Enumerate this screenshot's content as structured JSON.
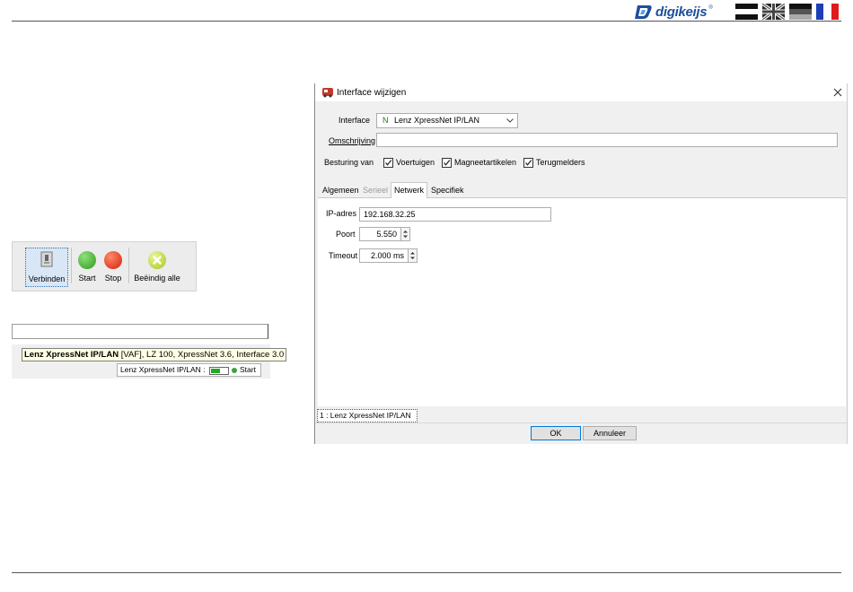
{
  "header": {
    "logo_text": "digikeijs",
    "logo_reg": "®",
    "flags": [
      "nl-flag",
      "uk-flag",
      "de-flag",
      "fr-flag"
    ]
  },
  "toolbar": {
    "connect_label": "Verbinden",
    "start_label": "Start",
    "stop_label": "Stop",
    "stop_all_label": "Beëindig alle"
  },
  "status": {
    "tooltip_bold": "Lenz XpressNet IP/LAN",
    "tooltip_rest": " [VAF], LZ 100, XpressNet 3.6, Interface 3.0",
    "connection_label": "Lenz XpressNet IP/LAN :",
    "connection_state": "Start"
  },
  "dialog": {
    "title": "Interface wijzigen",
    "interface_label": "Interface",
    "interface_prefix": "N",
    "interface_value": "Lenz XpressNet IP/LAN",
    "description_label": "Omschrijving",
    "description_value": "",
    "control_label": "Besturing van",
    "checks": [
      {
        "label": "Voertuigen",
        "checked": true
      },
      {
        "label": "Magneetartikelen",
        "checked": true
      },
      {
        "label": "Terugmelders",
        "checked": true
      }
    ],
    "tabs": [
      "Algemeen",
      "Serieel",
      "Netwerk",
      "Specifiek"
    ],
    "active_tab": "Netwerk",
    "ip_label": "IP-adres",
    "ip_value": "192.168.32.25",
    "port_label": "Poort",
    "port_value": "5.550",
    "timeout_label": "Timeout",
    "timeout_value": "2.000 ms",
    "list_item": "1 : Lenz XpressNet IP/LAN",
    "ok_label": "OK",
    "cancel_label": "Annuleer"
  }
}
